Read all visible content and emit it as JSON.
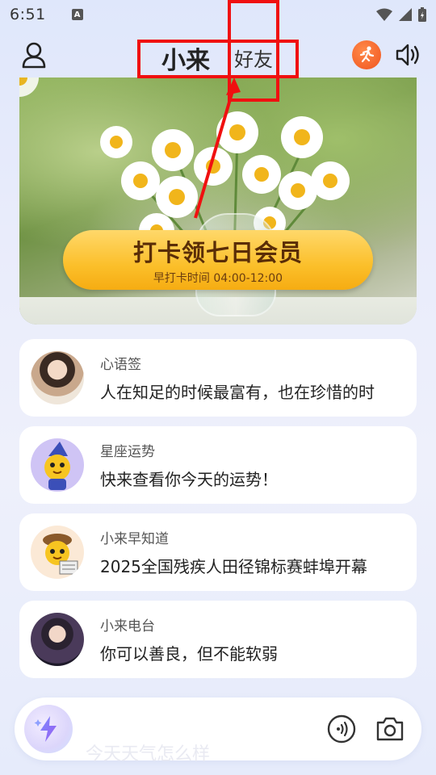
{
  "status_bar": {
    "time": "6:51",
    "notification_glyph": "A"
  },
  "header": {
    "title": "小来",
    "friends_label": "好友",
    "icons": [
      "user-icon",
      "runner-icon",
      "speaker-icon"
    ]
  },
  "banner": {
    "button_title": "打卡领七日会员",
    "button_subtitle": "早打卡时间 04:00-12:00"
  },
  "cards": [
    {
      "label": "心语签",
      "content": "人在知足的时候最富有，也在珍惜的时",
      "avatar": "woman-portrait"
    },
    {
      "label": "星座运势",
      "content": "快来查看你今天的运势！",
      "avatar": "wizard-mascot"
    },
    {
      "label": "小来早知道",
      "content": "2025全国残疾人田径锦标赛蚌埠开幕",
      "avatar": "newsboy-mascot"
    },
    {
      "label": "小来电台",
      "content": "你可以善良，但不能软弱",
      "avatar": "girl-portrait"
    }
  ],
  "input_bar": {
    "placeholder": "今天天气怎么样"
  },
  "colors": {
    "accent_orange": "#f0541e",
    "button_gold": "#fbbf2a",
    "annotation_red": "#f01010"
  }
}
